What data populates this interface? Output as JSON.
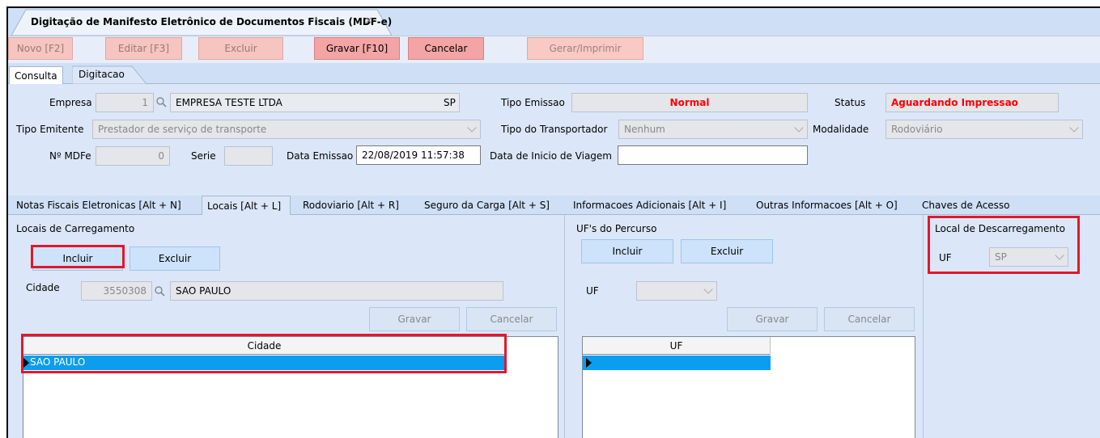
{
  "document_tab": {
    "title": "Digitação de Manifesto Eletrônico de Documentos Fiscais (MDF-e)",
    "close": "✕"
  },
  "toolbar": {
    "novo": "Novo [F2]",
    "editar": "Editar [F3]",
    "excluir": "Excluir",
    "gravar": "Gravar [F10]",
    "cancelar": "Cancelar",
    "gerar": "Gerar/Imprimir"
  },
  "main_tabs": {
    "consulta": "Consulta",
    "digitacao": "Digitacao"
  },
  "header": {
    "empresa_label": "Empresa",
    "empresa_code": "1",
    "empresa_name": "EMPRESA TESTE LTDA",
    "empresa_uf": "SP",
    "tipo_emissao_label": "Tipo Emissao",
    "tipo_emissao_value": "Normal",
    "status_label": "Status",
    "status_value": "Aguardando Impressao",
    "tipo_emitente_label": "Tipo Emitente",
    "tipo_emitente_value": "Prestador de serviço de transporte",
    "tipo_transportador_label": "Tipo do Transportador",
    "tipo_transportador_value": "Nenhum",
    "modalidade_label": "Modalidade",
    "modalidade_value": "Rodoviário",
    "nro_mdfe_label": "Nº MDFe",
    "nro_mdfe_value": "0",
    "serie_label": "Serie",
    "serie_value": "",
    "data_emissao_label": "Data Emissao",
    "data_emissao_value": "22/08/2019 11:57:38",
    "data_inicio_label": "Data de Inicio de Viagem",
    "data_inicio_value": ""
  },
  "sub_tabs": [
    "Notas Fiscais Eletronicas [Alt + N]",
    "Locais [Alt + L]",
    "Rodoviario [Alt + R]",
    "Seguro da Carga [Alt + S]",
    "Informacoes Adicionais [Alt + I]",
    "Outras Informacoes [Alt + O]",
    "Chaves de Acesso"
  ],
  "carregamento": {
    "title": "Locais de Carregamento",
    "incluir": "Incluir",
    "excluir": "Excluir",
    "cidade_label": "Cidade",
    "cidade_code": "3550308",
    "cidade_name": "SAO PAULO",
    "gravar": "Gravar",
    "cancelar": "Cancelar",
    "grid_header": "Cidade",
    "rows": [
      "SAO PAULO"
    ]
  },
  "percurso": {
    "title": "UF's do Percurso",
    "incluir": "Incluir",
    "excluir": "Excluir",
    "uf_label": "UF",
    "uf_value": "",
    "gravar": "Gravar",
    "cancelar": "Cancelar",
    "grid_header": "UF",
    "rows": [
      ""
    ]
  },
  "descarregamento": {
    "title": "Local de Descarregamento",
    "uf_label": "UF",
    "uf_value": "SP"
  },
  "colors": {
    "accent_red": "#e2172a",
    "status_red": "#ff0000",
    "selection": "#0a9df0"
  }
}
